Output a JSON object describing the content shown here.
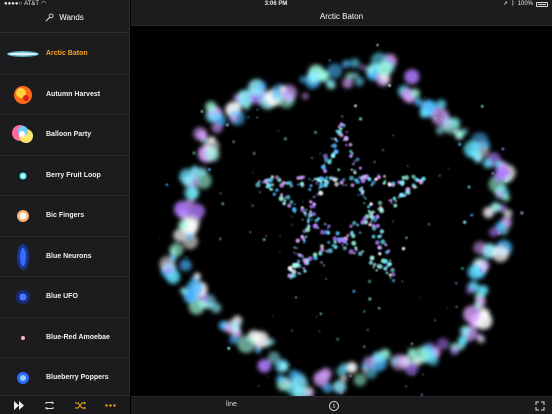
{
  "status_bar": {
    "carrier": "AT&T",
    "time": "3:06 PM",
    "battery": "100%"
  },
  "sidebar": {
    "title": "Wands",
    "items": [
      {
        "label": "Arctic Baton",
        "selected": true,
        "thumb": "arctic"
      },
      {
        "label": "Autumn Harvest",
        "selected": false,
        "thumb": "autumn"
      },
      {
        "label": "Balloon Party",
        "selected": false,
        "thumb": "balloon"
      },
      {
        "label": "Berry Fruit Loop",
        "selected": false,
        "thumb": "berry"
      },
      {
        "label": "Bic Fingers",
        "selected": false,
        "thumb": "bic"
      },
      {
        "label": "Blue Neurons",
        "selected": false,
        "thumb": "neurons"
      },
      {
        "label": "Blue UFO",
        "selected": false,
        "thumb": "ufo"
      },
      {
        "label": "Blue-Red Amoebae",
        "selected": false,
        "thumb": "amoebae"
      },
      {
        "label": "Blueberry Poppers",
        "selected": false,
        "thumb": "blueberry"
      }
    ]
  },
  "main": {
    "title": "Arctic Baton",
    "mode_label": "line"
  },
  "colors": {
    "accent": "#f5a623",
    "panel": "#1c1c1e",
    "particle_cyan": "#5fe3ff",
    "particle_violet": "#b07cff"
  }
}
